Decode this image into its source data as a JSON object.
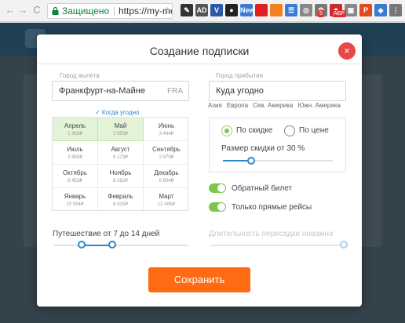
{
  "browser": {
    "back_label": "←",
    "forward_label": "→",
    "reload_label": "C",
    "secure_label": "Защищено",
    "url": "https://my-me...",
    "extensions": [
      {
        "name": "eyedropper-icon",
        "glyph": "✎",
        "color": "#333333"
      },
      {
        "name": "ad-icon",
        "glyph": "AD",
        "color": "#555555"
      },
      {
        "name": "v-icon",
        "glyph": "V",
        "color": "#2b5aa8"
      },
      {
        "name": "eye-icon",
        "glyph": "●",
        "color": "#222222"
      },
      {
        "name": "new-icon",
        "glyph": "New",
        "color": "#3a7bd5"
      },
      {
        "name": "red-square-icon",
        "glyph": "",
        "color": "#e02020"
      },
      {
        "name": "orange-square-icon",
        "glyph": "",
        "color": "#f08020"
      },
      {
        "name": "blue-icon",
        "glyph": "☰",
        "color": "#3a7bd5"
      },
      {
        "name": "gray-icon",
        "glyph": "◎",
        "color": "#888888"
      },
      {
        "name": "gear-icon",
        "glyph": "⚙",
        "color": "#777777"
      },
      {
        "name": "red-ext-icon",
        "glyph": "◆",
        "color": "#cc2b2b"
      },
      {
        "name": "gift-icon",
        "glyph": "▣",
        "color": "#888888"
      },
      {
        "name": "p-icon",
        "glyph": "P",
        "color": "#e24a1b"
      },
      {
        "name": "shield-icon",
        "glyph": "◈",
        "color": "#3a7bd5"
      },
      {
        "name": "menu-icon",
        "glyph": "⋮",
        "color": "#777777"
      }
    ],
    "badges": {
      "mail": "5",
      "abp": "ABP"
    }
  },
  "modal": {
    "title": "Создание подписки",
    "close_label": "×",
    "origin": {
      "label": "Город вылета",
      "value": "Франкфурт-на-Майне",
      "code": "FRA"
    },
    "destination": {
      "label": "Город прибытия",
      "value": "Куда угодно"
    },
    "regions": [
      "Азия",
      "Европа",
      "Сев. Америка",
      "Южн. Америка"
    ],
    "anytime_label": "✓ Когда угодно",
    "months": [
      {
        "name": "Апрель",
        "price": "1 369₽",
        "selected": true
      },
      {
        "name": "Май",
        "price": "2 955₽",
        "selected": true
      },
      {
        "name": "Июнь",
        "price": "3 444₽",
        "selected": false
      },
      {
        "name": "Июль",
        "price": "2 980₽",
        "selected": false
      },
      {
        "name": "Август",
        "price": "6 173₽",
        "selected": false
      },
      {
        "name": "Сентябрь",
        "price": "2 979₽",
        "selected": false
      },
      {
        "name": "Октябрь",
        "price": "8 453₽",
        "selected": false
      },
      {
        "name": "Ноябрь",
        "price": "8 162₽",
        "selected": false
      },
      {
        "name": "Декабрь",
        "price": "8 604₽",
        "selected": false
      },
      {
        "name": "Январь",
        "price": "10 094₽",
        "selected": false
      },
      {
        "name": "Февраль",
        "price": "6 415₽",
        "selected": false
      },
      {
        "name": "Март",
        "price": "12 485₽",
        "selected": false
      }
    ],
    "sort": {
      "by_discount": "По скидке",
      "by_price": "По цене",
      "selected": "by_discount",
      "discount_label": "Размер скидки от 30 %",
      "discount_value": 30
    },
    "return_ticket_label": "Обратный билет",
    "return_ticket_on": true,
    "direct_only_label": "Только прямые рейсы",
    "direct_only_on": true,
    "trip_label": "Путешествие от 7 до 14 дней",
    "trip_min_days": 7,
    "trip_max_days": 14,
    "transfer_label": "Длительность пересадки неважна",
    "save_label": "Сохранить"
  }
}
